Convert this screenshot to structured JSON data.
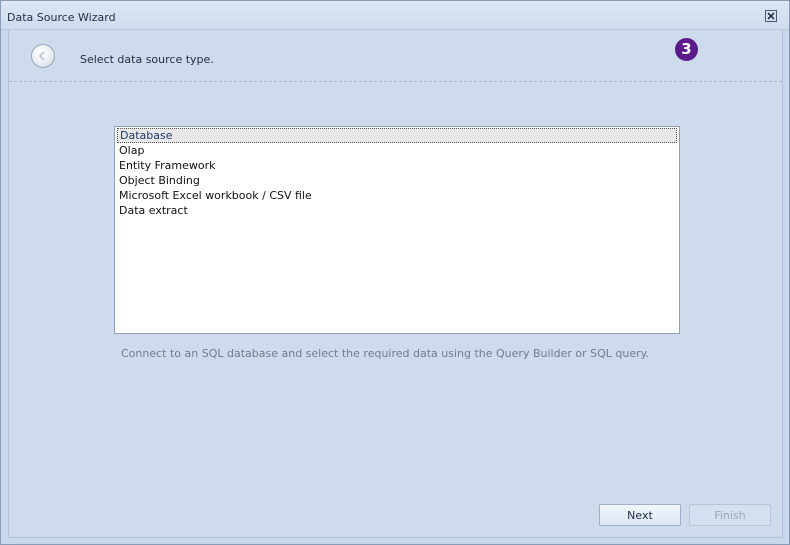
{
  "window": {
    "title": "Data Source Wizard"
  },
  "header": {
    "title": "Select data source type.",
    "step_number": "3"
  },
  "data_source_list": {
    "items": [
      {
        "label": "Database",
        "selected": true
      },
      {
        "label": "Olap",
        "selected": false
      },
      {
        "label": "Entity Framework",
        "selected": false
      },
      {
        "label": "Object Binding",
        "selected": false
      },
      {
        "label": "Microsoft Excel workbook / CSV file",
        "selected": false
      },
      {
        "label": "Data extract",
        "selected": false
      }
    ]
  },
  "description": "Connect to an SQL database and select the required data using the Query Builder or SQL query.",
  "buttons": {
    "next_label": "Next",
    "finish_label": "Finish",
    "finish_enabled": false
  },
  "colors": {
    "step_badge": "#5b1a8a",
    "background": "#cddbed"
  },
  "icons": {
    "close": "close-icon",
    "back": "back-arrow-icon"
  }
}
